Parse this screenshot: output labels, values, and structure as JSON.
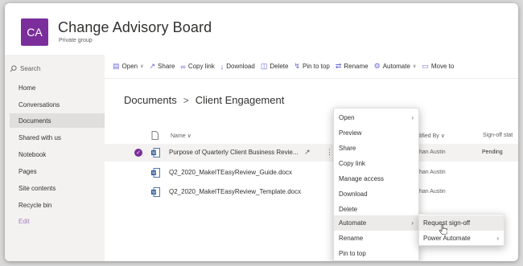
{
  "site": {
    "logo_initials": "CA",
    "title": "Change Advisory Board",
    "subtitle": "Private group",
    "brand_color": "#7b2e9b"
  },
  "nav": {
    "search_placeholder": "Search",
    "items": [
      {
        "label": "Home"
      },
      {
        "label": "Conversations"
      },
      {
        "label": "Documents",
        "selected": true
      },
      {
        "label": "Shared with us"
      },
      {
        "label": "Notebook"
      },
      {
        "label": "Pages"
      },
      {
        "label": "Site contents"
      },
      {
        "label": "Recycle bin"
      },
      {
        "label": "Edit"
      }
    ]
  },
  "commandbar": {
    "open": "Open",
    "share": "Share",
    "copy_link": "Copy link",
    "download": "Download",
    "delete": "Delete",
    "pin_to_top": "Pin to top",
    "rename": "Rename",
    "automate": "Automate",
    "move_to": "Move to"
  },
  "breadcrumb": {
    "root": "Documents",
    "separator": ">",
    "current": "Client Engagement"
  },
  "table": {
    "headers": {
      "name": "Name",
      "modified_by": "odified By",
      "signoff": "Sign-off stat"
    },
    "rows": [
      {
        "name": "Purpose of Quarterly Client Business Revie...",
        "modified_by": "than Austin",
        "status": "Pending",
        "selected": true
      },
      {
        "name": "Q2_2020_MakeITEasyReview_Guide.docx",
        "modified_by": "than Austin",
        "status": ""
      },
      {
        "name": "Q2_2020_MakeITEasyReview_Template.docx",
        "modified_by": "than Austin",
        "status": ""
      }
    ]
  },
  "context_menu": {
    "items": [
      {
        "label": "Open",
        "has_submenu": true
      },
      {
        "label": "Preview"
      },
      {
        "label": "Share"
      },
      {
        "label": "Copy link"
      },
      {
        "label": "Manage access"
      },
      {
        "label": "Download"
      },
      {
        "label": "Delete"
      },
      {
        "label": "Automate",
        "has_submenu": true,
        "active": true
      },
      {
        "label": "Rename"
      },
      {
        "label": "Pin to top"
      }
    ]
  },
  "submenu": {
    "items": [
      {
        "label": "Request sign-off",
        "hover": true
      },
      {
        "label": "Power Automate",
        "has_submenu": true
      }
    ]
  }
}
